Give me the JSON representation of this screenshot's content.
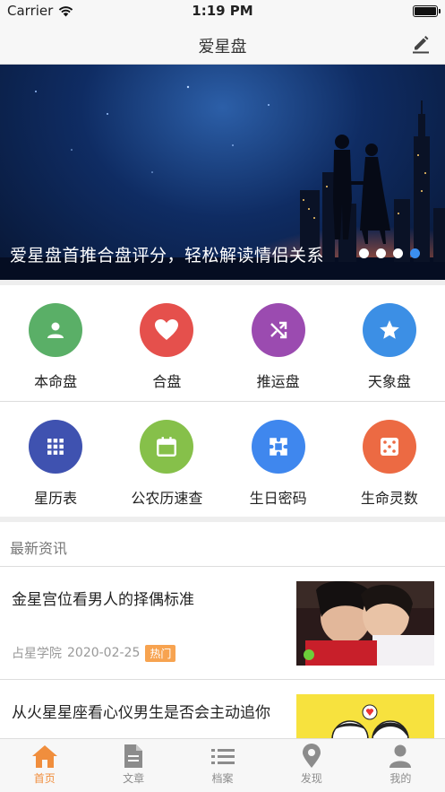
{
  "status": {
    "carrier": "Carrier",
    "time": "1:19 PM"
  },
  "nav": {
    "title": "爱星盘",
    "edit_icon": "edit-icon"
  },
  "banner": {
    "caption": "爱星盘首推合盘评分，轻松解读情侣关系",
    "slide_count": 4,
    "active_slide": 4
  },
  "grid": {
    "row1": [
      {
        "label": "本命盘",
        "icon": "person-icon",
        "color": "#5aaf67"
      },
      {
        "label": "合盘",
        "icon": "heart-icon",
        "color": "#e5504c"
      },
      {
        "label": "推运盘",
        "icon": "shuffle-icon",
        "color": "#9b4bb0"
      },
      {
        "label": "天象盘",
        "icon": "star-icon",
        "color": "#3c8fe5"
      }
    ],
    "row2": [
      {
        "label": "星历表",
        "icon": "grid-icon",
        "color": "#3f52b0"
      },
      {
        "label": "公农历速查",
        "icon": "calendar-icon",
        "color": "#86c04a"
      },
      {
        "label": "生日密码",
        "icon": "puzzle-icon",
        "color": "#3f87ee"
      },
      {
        "label": "生命灵数",
        "icon": "dice-icon",
        "color": "#ec6a43"
      }
    ]
  },
  "news": {
    "section_title": "最新资讯",
    "items": [
      {
        "title": "金星宫位看男人的择偶标准",
        "source": "占星学院",
        "date": "2020-02-25",
        "badge": "热门"
      },
      {
        "title": "从火星星座看心仪男生是否会主动追你"
      }
    ]
  },
  "tabs": [
    {
      "label": "首页",
      "icon": "home-icon",
      "active": true
    },
    {
      "label": "文章",
      "icon": "document-icon",
      "active": false
    },
    {
      "label": "档案",
      "icon": "list-icon",
      "active": false
    },
    {
      "label": "发现",
      "icon": "location-pin-icon",
      "active": false
    },
    {
      "label": "我的",
      "icon": "user-icon",
      "active": false
    }
  ],
  "colors": {
    "accent": "#f08e3d",
    "inactive": "#8c8c8c",
    "dot_active": "#3b8ff0"
  }
}
